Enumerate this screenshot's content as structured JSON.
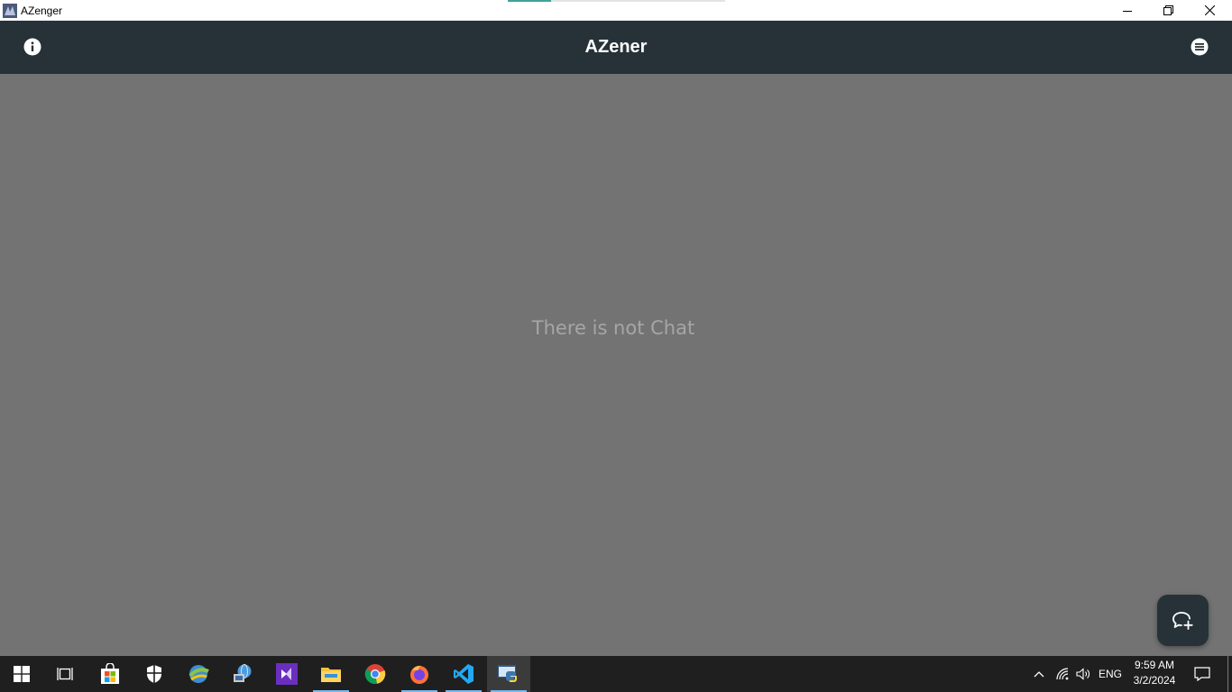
{
  "window": {
    "title": "AZenger",
    "controls": {
      "minimize": "minimize-icon",
      "restore": "restore-icon",
      "close": "close-icon"
    }
  },
  "appbar": {
    "title": "AZener",
    "left_icon": "info-icon",
    "right_icon": "menu-icon",
    "background": "#263238"
  },
  "main": {
    "empty_message": "There is not Chat",
    "background": "#737373"
  },
  "fab": {
    "icon": "new-chat-icon"
  },
  "taskbar": {
    "apps": [
      {
        "name": "start",
        "icon": "windows-icon"
      },
      {
        "name": "task-view",
        "icon": "task-view-icon"
      },
      {
        "name": "microsoft-store",
        "icon": "store-icon"
      },
      {
        "name": "windows-security",
        "icon": "shield-icon"
      },
      {
        "name": "internet-download-manager",
        "icon": "idm-icon"
      },
      {
        "name": "network-app",
        "icon": "globe-app-icon"
      },
      {
        "name": "visual-studio",
        "icon": "visual-studio-icon"
      },
      {
        "name": "file-explorer",
        "icon": "folder-icon"
      },
      {
        "name": "chrome",
        "icon": "chrome-icon"
      },
      {
        "name": "firefox",
        "icon": "firefox-icon"
      },
      {
        "name": "vscode",
        "icon": "vscode-icon"
      },
      {
        "name": "python",
        "icon": "python-icon"
      }
    ],
    "tray": {
      "language": "ENG",
      "time": "9:59 AM",
      "date": "3/2/2024"
    }
  }
}
